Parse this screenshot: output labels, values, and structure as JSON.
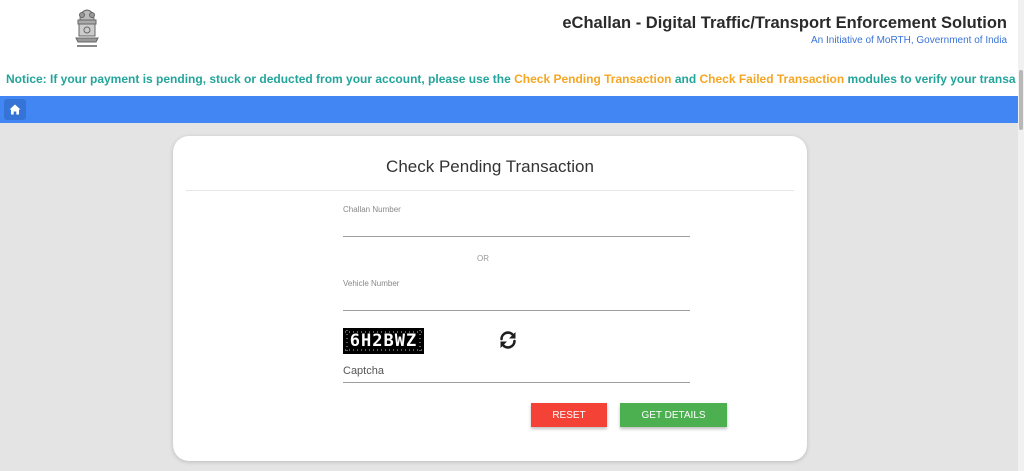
{
  "header": {
    "logo_icon": "national-emblem-icon",
    "title": "eChallan - Digital Traffic/Transport Enforcement Solution",
    "subtitle": "An Initiative of MoRTH, Government of India"
  },
  "notice": {
    "prefix": "Notice: If your payment is pending, stuck or deducted from your account, please use the ",
    "link1": "Check Pending Transaction",
    "middle": " and ",
    "link2": "Check Failed Transaction",
    "suffix": " modules to verify your transa",
    "color": "#23a59b",
    "highlight_color": "#f5a623"
  },
  "navbar": {
    "home_icon": "home-icon",
    "color": "#4286f4"
  },
  "form": {
    "title": "Check Pending Transaction",
    "challan_label": "Challan Number",
    "challan_value": "",
    "or_text": "OR",
    "vehicle_label": "Vehicle Number",
    "vehicle_value": "",
    "captcha_text": "6H2BWZ",
    "refresh_icon": "refresh-icon",
    "captcha_placeholder": "Captcha",
    "captcha_value": "",
    "reset_label": "RESET",
    "get_details_label": "GET DETAILS",
    "reset_color": "#f44336",
    "get_details_color": "#4caf50"
  }
}
